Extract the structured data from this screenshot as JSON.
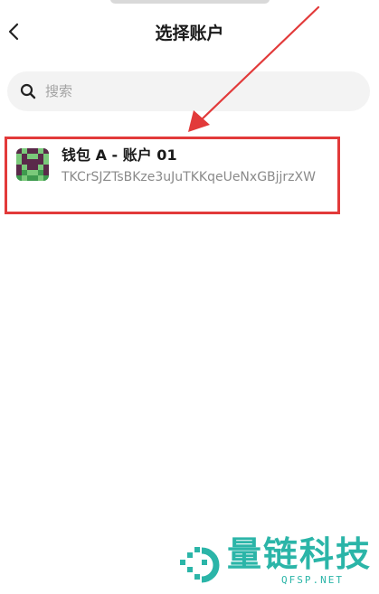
{
  "header": {
    "title": "选择账户",
    "back_icon": "chevron-left-icon"
  },
  "search": {
    "placeholder": "搜索",
    "value": "",
    "icon": "search-icon"
  },
  "accounts": [
    {
      "name": "钱包 A - 账户 01",
      "address": "TKCrSJZTsBKze3uJuTKKqeUeNxGBjjrzXW",
      "avatar": "identicon-avatar",
      "highlighted": true
    }
  ],
  "annotation": {
    "arrow_color": "#e23a3a",
    "highlight_color": "#e23a3a"
  },
  "watermark": {
    "text": "量链科技",
    "subtext": "QFSP.NET",
    "color": "#2bb5a8"
  }
}
